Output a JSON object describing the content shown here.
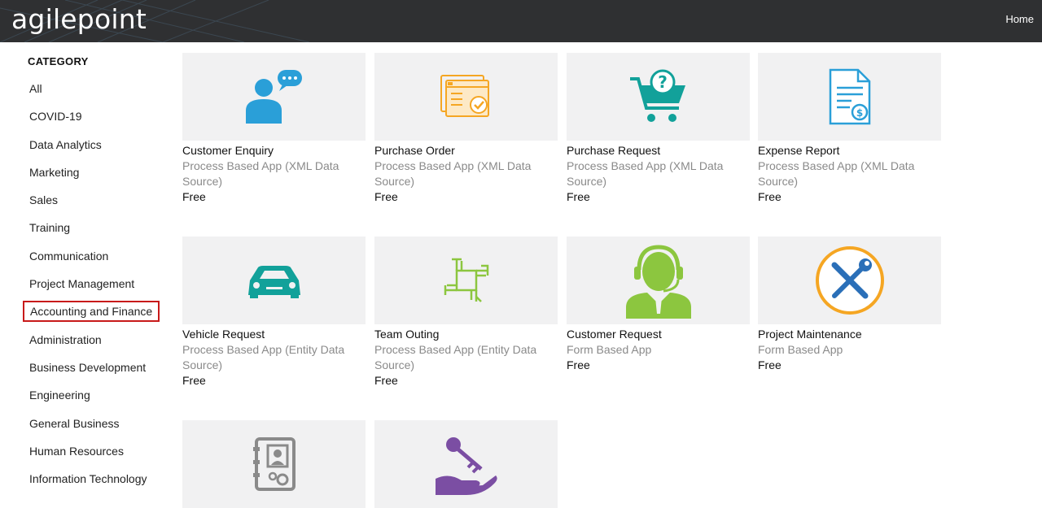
{
  "header": {
    "logo": "agilepoint",
    "home_label": "Home"
  },
  "sidebar": {
    "heading": "CATEGORY",
    "items": [
      {
        "label": "All"
      },
      {
        "label": "COVID-19"
      },
      {
        "label": "Data Analytics"
      },
      {
        "label": "Marketing"
      },
      {
        "label": "Sales"
      },
      {
        "label": "Training"
      },
      {
        "label": "Communication"
      },
      {
        "label": "Project Management"
      },
      {
        "label": "Accounting and Finance",
        "selected": true
      },
      {
        "label": "Administration"
      },
      {
        "label": "Business Development"
      },
      {
        "label": "Engineering"
      },
      {
        "label": "General Business"
      },
      {
        "label": "Human Resources"
      },
      {
        "label": "Information Technology"
      }
    ]
  },
  "apps": [
    {
      "title": "Customer Enquiry",
      "subtitle": "Process Based App (XML Data Source)",
      "price": "Free",
      "icon": "customer-chat-icon",
      "color": "#2a9fd8"
    },
    {
      "title": "Purchase Order",
      "subtitle": "Process Based App (XML Data Source)",
      "price": "Free",
      "icon": "purchase-order-icon",
      "color": "#f5a623"
    },
    {
      "title": "Purchase Request",
      "subtitle": "Process Based App (XML Data Source)",
      "price": "Free",
      "icon": "shopping-cart-question-icon",
      "color": "#12a19a"
    },
    {
      "title": "Expense Report",
      "subtitle": "Process Based App (XML Data Source)",
      "price": "Free",
      "icon": "expense-document-icon",
      "color": "#2a9fd8"
    },
    {
      "title": "Vehicle Request",
      "subtitle": "Process Based App (Entity Data Source)",
      "price": "Free",
      "icon": "car-icon",
      "color": "#12a19a"
    },
    {
      "title": "Team Outing",
      "subtitle": "Process Based App (Entity Data Source)",
      "price": "Free",
      "icon": "team-hands-icon",
      "color": "#8cc63f"
    },
    {
      "title": "Customer Request",
      "subtitle": "Form Based App",
      "price": "Free",
      "icon": "support-agent-icon",
      "color": "#8cc63f"
    },
    {
      "title": "Project Maintenance",
      "subtitle": "Form Based App",
      "price": "Free",
      "icon": "tools-icon",
      "color": "#f5a623"
    },
    {
      "title": "",
      "subtitle": "",
      "price": "",
      "icon": "contact-book-gear-icon",
      "color": "#8a8a8a"
    },
    {
      "title": "",
      "subtitle": "",
      "price": "",
      "icon": "hand-key-icon",
      "color": "#7b4ea3"
    }
  ]
}
